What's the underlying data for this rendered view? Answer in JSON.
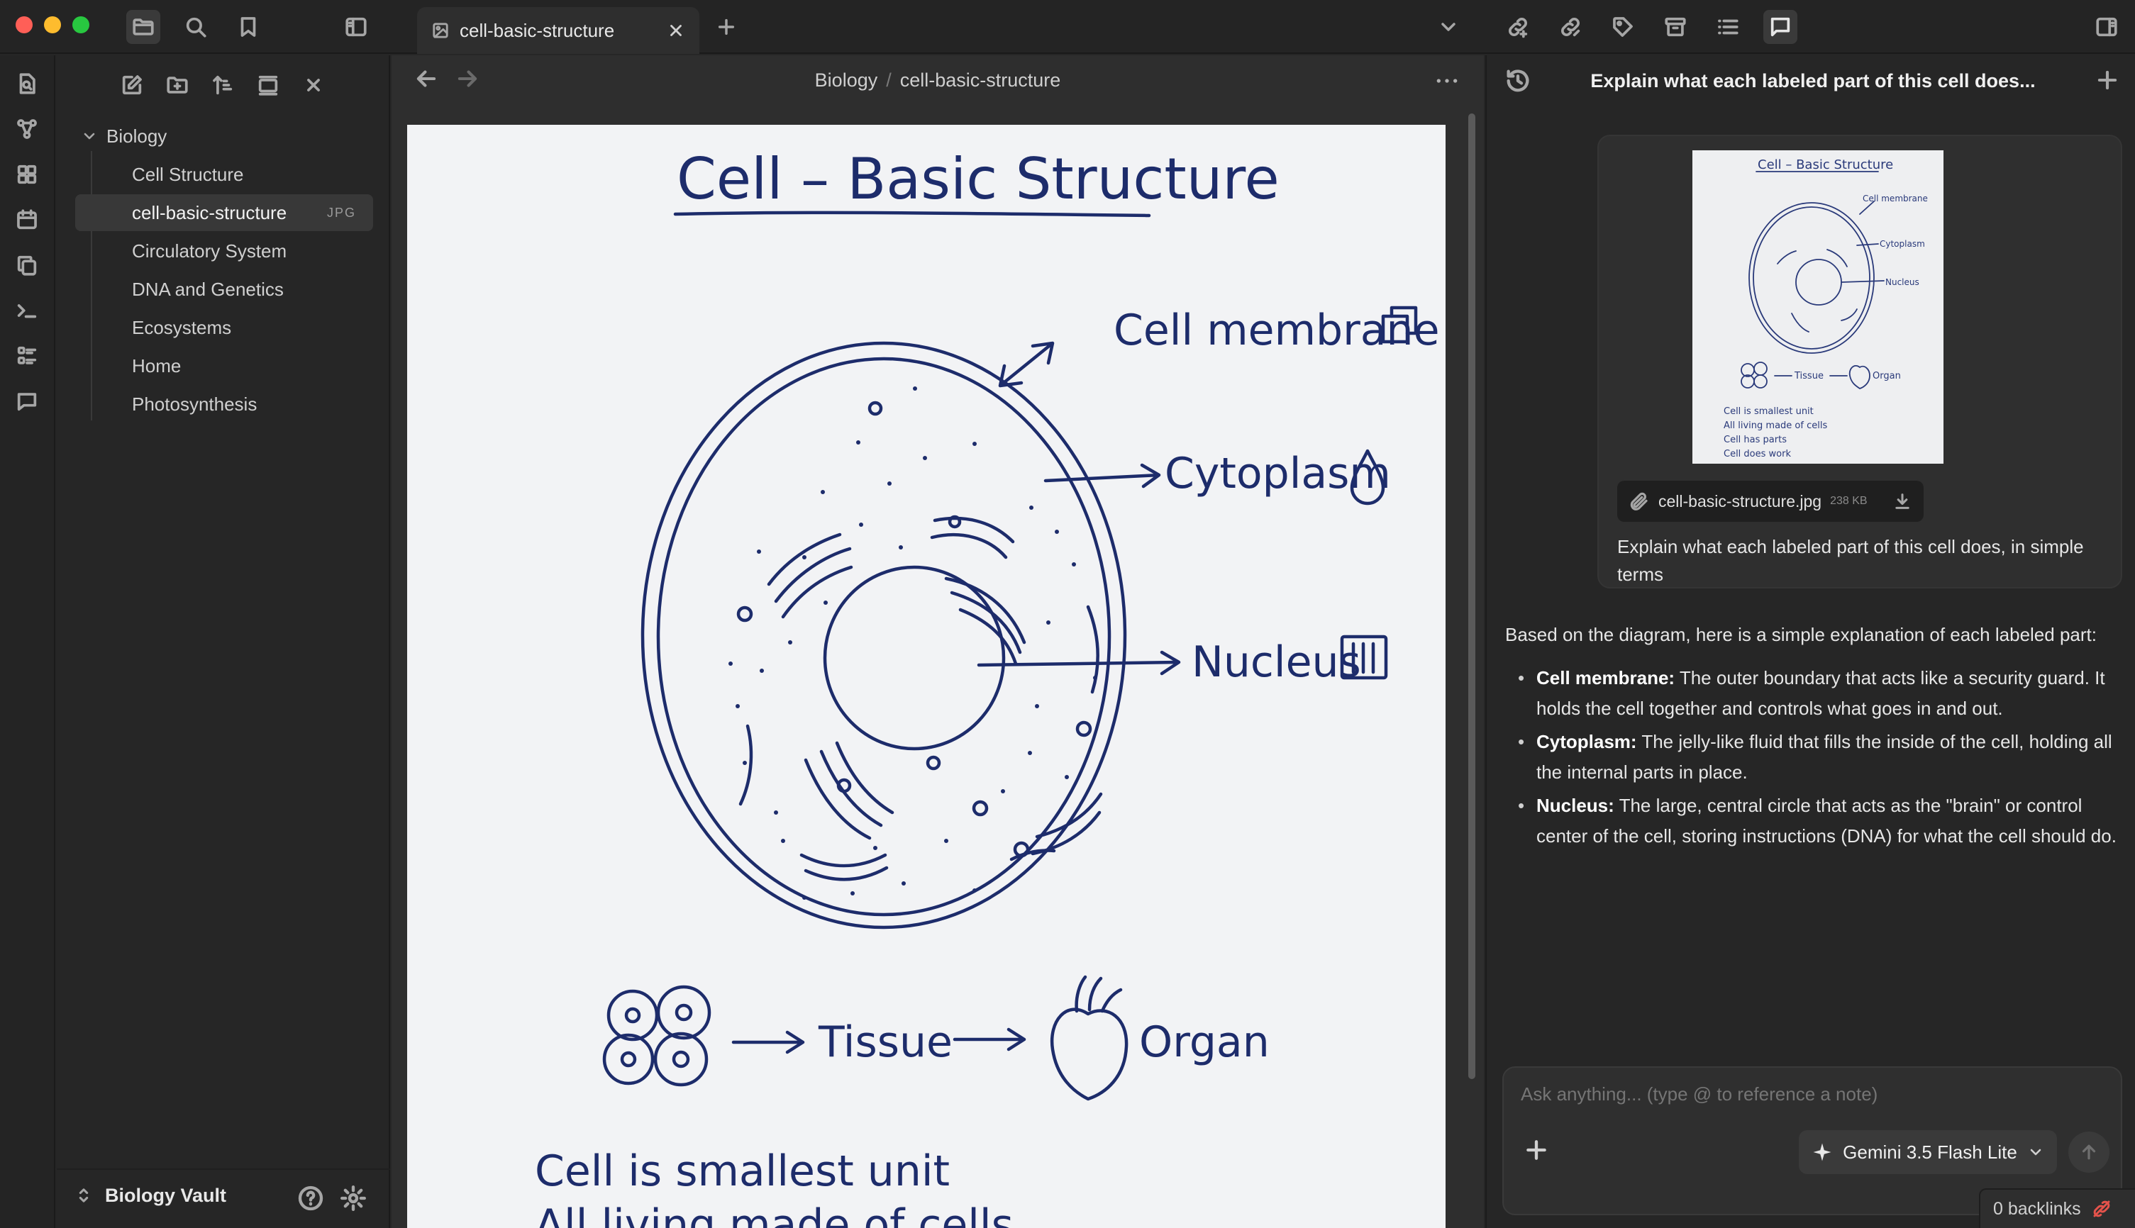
{
  "window": {
    "tab_title": "cell-basic-structure"
  },
  "colors": {
    "accent_red": "#e5534b",
    "ink": "#1d2c6b"
  },
  "icons": {
    "titlebar_left": [
      "folder-icon",
      "search-icon",
      "bookmark-icon",
      "sidebar-toggle-icon"
    ],
    "titlebar_right": [
      "chevron-down-icon",
      "link-icon",
      "link-alt-icon",
      "tag-icon",
      "archive-icon",
      "list-icon",
      "chat-icon",
      "right-sidebar-icon"
    ],
    "ribbon": [
      "file-search-icon",
      "graph-icon",
      "dashboard-icon",
      "calendar-icon",
      "copy-icon",
      "terminal-icon",
      "list-grid-icon",
      "comment-icon"
    ],
    "sidebar_toolbar": [
      "new-note-icon",
      "new-folder-icon",
      "sort-icon",
      "collapse-icon",
      "close-all-icon"
    ]
  },
  "sidebar": {
    "folder": "Biology",
    "items": [
      {
        "label": "Cell Structure",
        "badge": ""
      },
      {
        "label": "cell-basic-structure",
        "badge": "JPG"
      },
      {
        "label": "Circulatory System",
        "badge": ""
      },
      {
        "label": "DNA and Genetics",
        "badge": ""
      },
      {
        "label": "Ecosystems",
        "badge": ""
      },
      {
        "label": "Home",
        "badge": ""
      },
      {
        "label": "Photosynthesis",
        "badge": ""
      }
    ],
    "vault_name": "Biology Vault"
  },
  "main": {
    "breadcrumb_folder": "Biology",
    "breadcrumb_sep": "/",
    "breadcrumb_file": "cell-basic-structure",
    "image": {
      "title": "Cell – Basic Structure",
      "label_membrane": "Cell membrane",
      "label_cytoplasm": "Cytoplasm",
      "label_nucleus": "Nucleus",
      "label_tissue": "Tissue",
      "label_organ": "Organ",
      "note_line1": "Cell is smallest unit",
      "note_line2": "All living made of cells"
    }
  },
  "chat": {
    "title": "Explain what each labeled part of this cell does...",
    "thumbnail": {
      "title": "Cell – Basic Structure",
      "label_membrane": "Cell membrane",
      "label_cytoplasm": "Cytoplasm",
      "label_nucleus": "Nucleus",
      "label_tissue": "Tissue",
      "label_organ": "Organ",
      "notes": [
        "Cell is smallest unit",
        "All living made of cells",
        "Cell has parts",
        "Cell does work"
      ]
    },
    "attachment": {
      "name": "cell-basic-structure.jpg",
      "size": "238 KB"
    },
    "user_message": "Explain what each labeled part of this cell does, in simple terms",
    "response_intro": "Based on the diagram, here is a simple explanation of each labeled part:",
    "response_items": [
      {
        "term": "Cell membrane:",
        "text": " The outer boundary that acts like a security guard. It holds the cell together and controls what goes in and out."
      },
      {
        "term": "Cytoplasm:",
        "text": " The jelly-like fluid that fills the inside of the cell, holding all the internal parts in place."
      },
      {
        "term": "Nucleus:",
        "text": " The large, central circle that acts as the \"brain\" or control center of the cell, storing instructions (DNA) for what the cell should do."
      }
    ],
    "input_placeholder": "Ask anything... (type @ to reference a note)",
    "model": "Gemini 3.5 Flash Lite"
  },
  "status_bar": {
    "backlinks": "0 backlinks"
  }
}
